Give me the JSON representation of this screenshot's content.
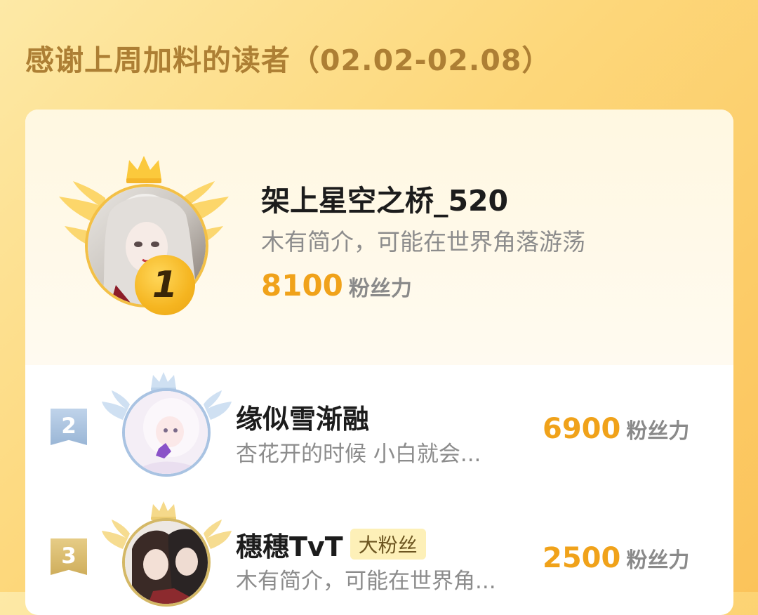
{
  "page": {
    "title": "感谢上周加料的读者（02.02-02.08）"
  },
  "first": {
    "rank": "1",
    "name": "架上星空之桥_520",
    "bio": "木有简介，可能在世界角落游荡",
    "score": "8100",
    "unit": "粉丝力"
  },
  "rows": [
    {
      "rank": "2",
      "name": "缘似雪渐融",
      "bio": "杏花开的时候 小白就会...",
      "score": "6900",
      "unit": "粉丝力",
      "badge": ""
    },
    {
      "rank": "3",
      "name": "穗穗TvT",
      "bio": "木有简介，可能在世界角...",
      "score": "2500",
      "unit": "粉丝力",
      "badge": "大粉丝"
    }
  ],
  "colors": {
    "gold": "#f0a21a",
    "title_brown": "#ad7f34",
    "silver": "#9ab6d6",
    "bronze": "#cfae5c"
  },
  "icons": {
    "first_emblem": "gold-crown-wings-icon",
    "second_emblem": "silver-crown-wings-icon",
    "third_emblem": "gold-crown-wings-icon"
  }
}
